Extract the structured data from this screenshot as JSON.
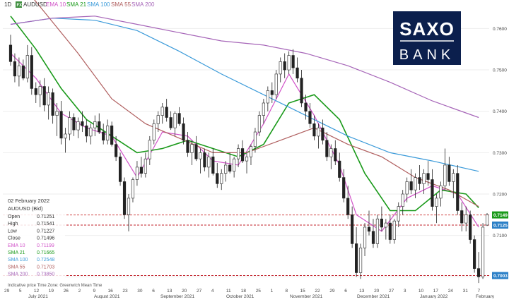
{
  "header": {
    "timeframe": "1D",
    "symbol_badge": "FX",
    "symbol": "AUDUSD",
    "indicators": [
      {
        "label": "EMA 10",
        "color": "#d152c8"
      },
      {
        "label": "SMA 21",
        "color": "#1a9a1a"
      },
      {
        "label": "SMA 100",
        "color": "#3a9ad9"
      },
      {
        "label": "SMA 55",
        "color": "#b05f5f"
      },
      {
        "label": "SMA 200",
        "color": "#a665b8"
      }
    ]
  },
  "logo": {
    "line1": "SAXO",
    "line2": "BANK",
    "color": "#0b1f4d"
  },
  "colors": {
    "up_candle": "#ffffff",
    "down_candle": "#222222",
    "candle_outline": "#222222",
    "price_line": "#d14a4a",
    "support_line": "#c0202a",
    "label_green": "#1a9a1a",
    "label_blue": "#2a7fc7",
    "grid": "#eeeeee"
  },
  "info_panel": {
    "date": "02 February 2022",
    "instrument": "AUDUSD (Bid)",
    "rows": [
      {
        "label": "Open",
        "value": "0.71251",
        "color": "#333333"
      },
      {
        "label": "High",
        "value": "0.71541",
        "color": "#333333"
      },
      {
        "label": "Low",
        "value": "0.71227",
        "color": "#333333"
      },
      {
        "label": "Close",
        "value": "0.71496",
        "color": "#333333"
      },
      {
        "label": "EMA 10",
        "value": "0.71199",
        "color": "#d152c8"
      },
      {
        "label": "SMA 21",
        "value": "0.71665",
        "color": "#1a9a1a"
      },
      {
        "label": "SMA 100",
        "value": "0.72548",
        "color": "#3a9ad9"
      },
      {
        "label": "SMA 55",
        "value": "0.71703",
        "color": "#b05f5f"
      },
      {
        "label": "SMA 200",
        "value": "0.73850",
        "color": "#a665b8"
      }
    ],
    "footer": "Indicative price   Time Zone: Greenwich Mean Time"
  },
  "chart_data": {
    "type": "candlestick",
    "ylim": [
      0.6975,
      0.7645
    ],
    "y_ticks": [
      "0.7600",
      "0.7500",
      "0.7400",
      "0.7300",
      "0.7200",
      "0.7100",
      "0.7000"
    ],
    "y_tick_values": [
      0.76,
      0.75,
      0.74,
      0.73,
      0.72,
      0.71,
      0.7
    ],
    "price_labels": [
      {
        "text": "0.7149",
        "value": 0.71496,
        "color": "#1a9a1a"
      },
      {
        "text": "0.7125",
        "value": 0.71251,
        "color": "#2a7fc7"
      },
      {
        "text": "0.7003",
        "value": 0.70032,
        "color": "#2a7fc7"
      }
    ],
    "horizontal_lines": [
      {
        "value": 0.71496,
        "style": "dashed",
        "color": "#d14a4a"
      },
      {
        "value": 0.71251,
        "style": "dashed",
        "color": "#c0202a"
      },
      {
        "value": 0.70032,
        "style": "dashed",
        "color": "#c0202a"
      }
    ],
    "day_ticks": [
      "29",
      "5",
      "12",
      "19",
      "26",
      "2",
      "9",
      "16",
      "23",
      "30",
      "6",
      "13",
      "20",
      "27",
      "4",
      "11",
      "18",
      "25",
      "1",
      "8",
      "15",
      "22",
      "29",
      "6",
      "13",
      "20",
      "27",
      "3",
      "10",
      "17",
      "24",
      "31",
      "7"
    ],
    "month_labels": [
      "July 2021",
      "August 2021",
      "September 2021",
      "October 2021",
      "November 2021",
      "December 2021",
      "January 2022",
      "February"
    ],
    "candles": [
      [
        0.756,
        0.7585,
        0.751,
        0.752
      ],
      [
        0.752,
        0.754,
        0.747,
        0.7485
      ],
      [
        0.7485,
        0.753,
        0.746,
        0.751
      ],
      [
        0.751,
        0.7525,
        0.7475,
        0.748
      ],
      [
        0.748,
        0.756,
        0.747,
        0.7535
      ],
      [
        0.7535,
        0.7555,
        0.744,
        0.7455
      ],
      [
        0.7455,
        0.747,
        0.742,
        0.744
      ],
      [
        0.744,
        0.7475,
        0.741,
        0.746
      ],
      [
        0.746,
        0.748,
        0.74,
        0.7415
      ],
      [
        0.7415,
        0.746,
        0.738,
        0.7445
      ],
      [
        0.7445,
        0.7455,
        0.737,
        0.739
      ],
      [
        0.739,
        0.742,
        0.734,
        0.74
      ],
      [
        0.74,
        0.7425,
        0.732,
        0.7335
      ],
      [
        0.7335,
        0.736,
        0.73,
        0.7345
      ],
      [
        0.7345,
        0.74,
        0.733,
        0.7385
      ],
      [
        0.7385,
        0.7395,
        0.734,
        0.7355
      ],
      [
        0.7355,
        0.7385,
        0.7335,
        0.7375
      ],
      [
        0.7375,
        0.74,
        0.735,
        0.7365
      ],
      [
        0.7365,
        0.738,
        0.7325,
        0.734
      ],
      [
        0.734,
        0.737,
        0.732,
        0.736
      ],
      [
        0.736,
        0.739,
        0.734,
        0.7375
      ],
      [
        0.7375,
        0.7395,
        0.7345,
        0.735
      ],
      [
        0.735,
        0.737,
        0.732,
        0.733
      ],
      [
        0.733,
        0.738,
        0.732,
        0.7365
      ],
      [
        0.7365,
        0.7375,
        0.7315,
        0.732
      ],
      [
        0.732,
        0.734,
        0.728,
        0.729
      ],
      [
        0.729,
        0.73,
        0.722,
        0.723
      ],
      [
        0.723,
        0.724,
        0.714,
        0.715
      ],
      [
        0.715,
        0.72,
        0.711,
        0.719
      ],
      [
        0.719,
        0.724,
        0.718,
        0.7235
      ],
      [
        0.7235,
        0.728,
        0.722,
        0.7265
      ],
      [
        0.7265,
        0.729,
        0.724,
        0.725
      ],
      [
        0.725,
        0.73,
        0.724,
        0.7285
      ],
      [
        0.7285,
        0.734,
        0.727,
        0.733
      ],
      [
        0.733,
        0.738,
        0.732,
        0.737
      ],
      [
        0.737,
        0.74,
        0.735,
        0.739
      ],
      [
        0.739,
        0.742,
        0.737,
        0.741
      ],
      [
        0.741,
        0.743,
        0.7375,
        0.7385
      ],
      [
        0.7385,
        0.74,
        0.7355,
        0.736
      ],
      [
        0.736,
        0.74,
        0.734,
        0.7395
      ],
      [
        0.7395,
        0.741,
        0.7365,
        0.737
      ],
      [
        0.737,
        0.7385,
        0.732,
        0.733
      ],
      [
        0.733,
        0.735,
        0.729,
        0.73
      ],
      [
        0.73,
        0.733,
        0.727,
        0.732
      ],
      [
        0.732,
        0.734,
        0.728,
        0.7285
      ],
      [
        0.7285,
        0.731,
        0.725,
        0.73
      ],
      [
        0.73,
        0.731,
        0.7255,
        0.7265
      ],
      [
        0.7265,
        0.73,
        0.724,
        0.729
      ],
      [
        0.729,
        0.731,
        0.7245,
        0.725
      ],
      [
        0.725,
        0.7275,
        0.7215,
        0.7225
      ],
      [
        0.7225,
        0.726,
        0.721,
        0.725
      ],
      [
        0.725,
        0.728,
        0.723,
        0.727
      ],
      [
        0.727,
        0.73,
        0.725,
        0.7255
      ],
      [
        0.7255,
        0.729,
        0.724,
        0.7285
      ],
      [
        0.7285,
        0.732,
        0.7265,
        0.731
      ],
      [
        0.731,
        0.733,
        0.7275,
        0.728
      ],
      [
        0.728,
        0.73,
        0.725,
        0.729
      ],
      [
        0.729,
        0.732,
        0.727,
        0.7315
      ],
      [
        0.7315,
        0.736,
        0.73,
        0.735
      ],
      [
        0.735,
        0.74,
        0.734,
        0.739
      ],
      [
        0.739,
        0.743,
        0.737,
        0.742
      ],
      [
        0.742,
        0.746,
        0.74,
        0.745
      ],
      [
        0.745,
        0.747,
        0.742,
        0.744
      ],
      [
        0.744,
        0.75,
        0.743,
        0.749
      ],
      [
        0.749,
        0.753,
        0.747,
        0.752
      ],
      [
        0.752,
        0.754,
        0.748,
        0.75
      ],
      [
        0.75,
        0.7545,
        0.749,
        0.7535
      ],
      [
        0.7535,
        0.755,
        0.749,
        0.7505
      ],
      [
        0.7505,
        0.753,
        0.747,
        0.748
      ],
      [
        0.748,
        0.75,
        0.741,
        0.742
      ],
      [
        0.742,
        0.744,
        0.738,
        0.74
      ],
      [
        0.74,
        0.742,
        0.736,
        0.737
      ],
      [
        0.737,
        0.739,
        0.733,
        0.734
      ],
      [
        0.734,
        0.737,
        0.731,
        0.736
      ],
      [
        0.736,
        0.738,
        0.732,
        0.733
      ],
      [
        0.733,
        0.735,
        0.728,
        0.729
      ],
      [
        0.729,
        0.732,
        0.726,
        0.731
      ],
      [
        0.731,
        0.733,
        0.727,
        0.728
      ],
      [
        0.728,
        0.73,
        0.723,
        0.724
      ],
      [
        0.724,
        0.726,
        0.718,
        0.719
      ],
      [
        0.719,
        0.722,
        0.714,
        0.715
      ],
      [
        0.715,
        0.717,
        0.707,
        0.708
      ],
      [
        0.708,
        0.712,
        0.7,
        0.701
      ],
      [
        0.701,
        0.708,
        0.6995,
        0.707
      ],
      [
        0.707,
        0.713,
        0.705,
        0.712
      ],
      [
        0.712,
        0.716,
        0.71,
        0.711
      ],
      [
        0.711,
        0.714,
        0.707,
        0.708
      ],
      [
        0.708,
        0.715,
        0.707,
        0.714
      ],
      [
        0.714,
        0.717,
        0.711,
        0.712
      ],
      [
        0.712,
        0.714,
        0.709,
        0.713
      ],
      [
        0.713,
        0.715,
        0.708,
        0.709
      ],
      [
        0.709,
        0.714,
        0.708,
        0.7135
      ],
      [
        0.7135,
        0.718,
        0.712,
        0.717
      ],
      [
        0.717,
        0.721,
        0.715,
        0.72
      ],
      [
        0.72,
        0.724,
        0.718,
        0.723
      ],
      [
        0.723,
        0.726,
        0.72,
        0.721
      ],
      [
        0.721,
        0.725,
        0.719,
        0.724
      ],
      [
        0.724,
        0.727,
        0.721,
        0.7225
      ],
      [
        0.7225,
        0.726,
        0.72,
        0.725
      ],
      [
        0.725,
        0.728,
        0.722,
        0.7235
      ],
      [
        0.7235,
        0.726,
        0.716,
        0.717
      ],
      [
        0.717,
        0.72,
        0.713,
        0.719
      ],
      [
        0.719,
        0.723,
        0.717,
        0.722
      ],
      [
        0.722,
        0.731,
        0.721,
        0.727
      ],
      [
        0.727,
        0.729,
        0.722,
        0.723
      ],
      [
        0.723,
        0.726,
        0.719,
        0.725
      ],
      [
        0.725,
        0.727,
        0.715,
        0.716
      ],
      [
        0.716,
        0.718,
        0.711,
        0.713
      ],
      [
        0.713,
        0.717,
        0.711,
        0.715
      ],
      [
        0.715,
        0.716,
        0.708,
        0.709
      ],
      [
        0.709,
        0.71,
        0.701,
        0.702
      ],
      [
        0.702,
        0.706,
        0.6985,
        0.7
      ],
      [
        0.7,
        0.713,
        0.6995,
        0.712
      ],
      [
        0.7125,
        0.7154,
        0.7123,
        0.715
      ]
    ],
    "series": [
      {
        "name": "EMA 10",
        "color": "#d152c8",
        "x": [
          0,
          6,
          12,
          18,
          24,
          30,
          36,
          42,
          48,
          54,
          60,
          66,
          72,
          78,
          82,
          88,
          94,
          100,
          106,
          111
        ],
        "values": [
          0.754,
          0.748,
          0.7395,
          0.736,
          0.734,
          0.724,
          0.735,
          0.734,
          0.728,
          0.727,
          0.737,
          0.749,
          0.739,
          0.727,
          0.715,
          0.711,
          0.719,
          0.722,
          0.72,
          0.712
        ]
      },
      {
        "name": "SMA 21",
        "color": "#1a9a1a",
        "x": [
          0,
          6,
          12,
          18,
          24,
          30,
          36,
          42,
          48,
          54,
          60,
          66,
          72,
          78,
          84,
          90,
          96,
          102,
          108,
          111
        ],
        "values": [
          0.763,
          0.755,
          0.7455,
          0.738,
          0.734,
          0.73,
          0.731,
          0.733,
          0.731,
          0.729,
          0.732,
          0.742,
          0.744,
          0.738,
          0.725,
          0.716,
          0.716,
          0.721,
          0.72,
          0.7167
        ]
      },
      {
        "name": "SMA 100",
        "color": "#3a9ad9",
        "x": [
          0,
          10,
          20,
          30,
          40,
          50,
          60,
          70,
          80,
          90,
          100,
          111
        ],
        "values": [
          0.761,
          0.7625,
          0.762,
          0.7595,
          0.7545,
          0.749,
          0.744,
          0.739,
          0.734,
          0.73,
          0.728,
          0.7255
        ]
      },
      {
        "name": "SMA 55",
        "color": "#b05f5f",
        "x": [
          0,
          8,
          16,
          24,
          32,
          40,
          48,
          56,
          64,
          72,
          80,
          88,
          96,
          104,
          111
        ],
        "values": [
          0.774,
          0.764,
          0.754,
          0.743,
          0.737,
          0.7335,
          0.73,
          0.73,
          0.733,
          0.736,
          0.732,
          0.729,
          0.724,
          0.721,
          0.717
        ]
      },
      {
        "name": "SMA 200",
        "color": "#a665b8",
        "x": [
          0,
          10,
          20,
          30,
          40,
          50,
          60,
          70,
          80,
          90,
          100,
          111
        ],
        "values": [
          0.761,
          0.7625,
          0.763,
          0.761,
          0.759,
          0.757,
          0.756,
          0.754,
          0.751,
          0.747,
          0.7425,
          0.7385
        ]
      }
    ]
  }
}
